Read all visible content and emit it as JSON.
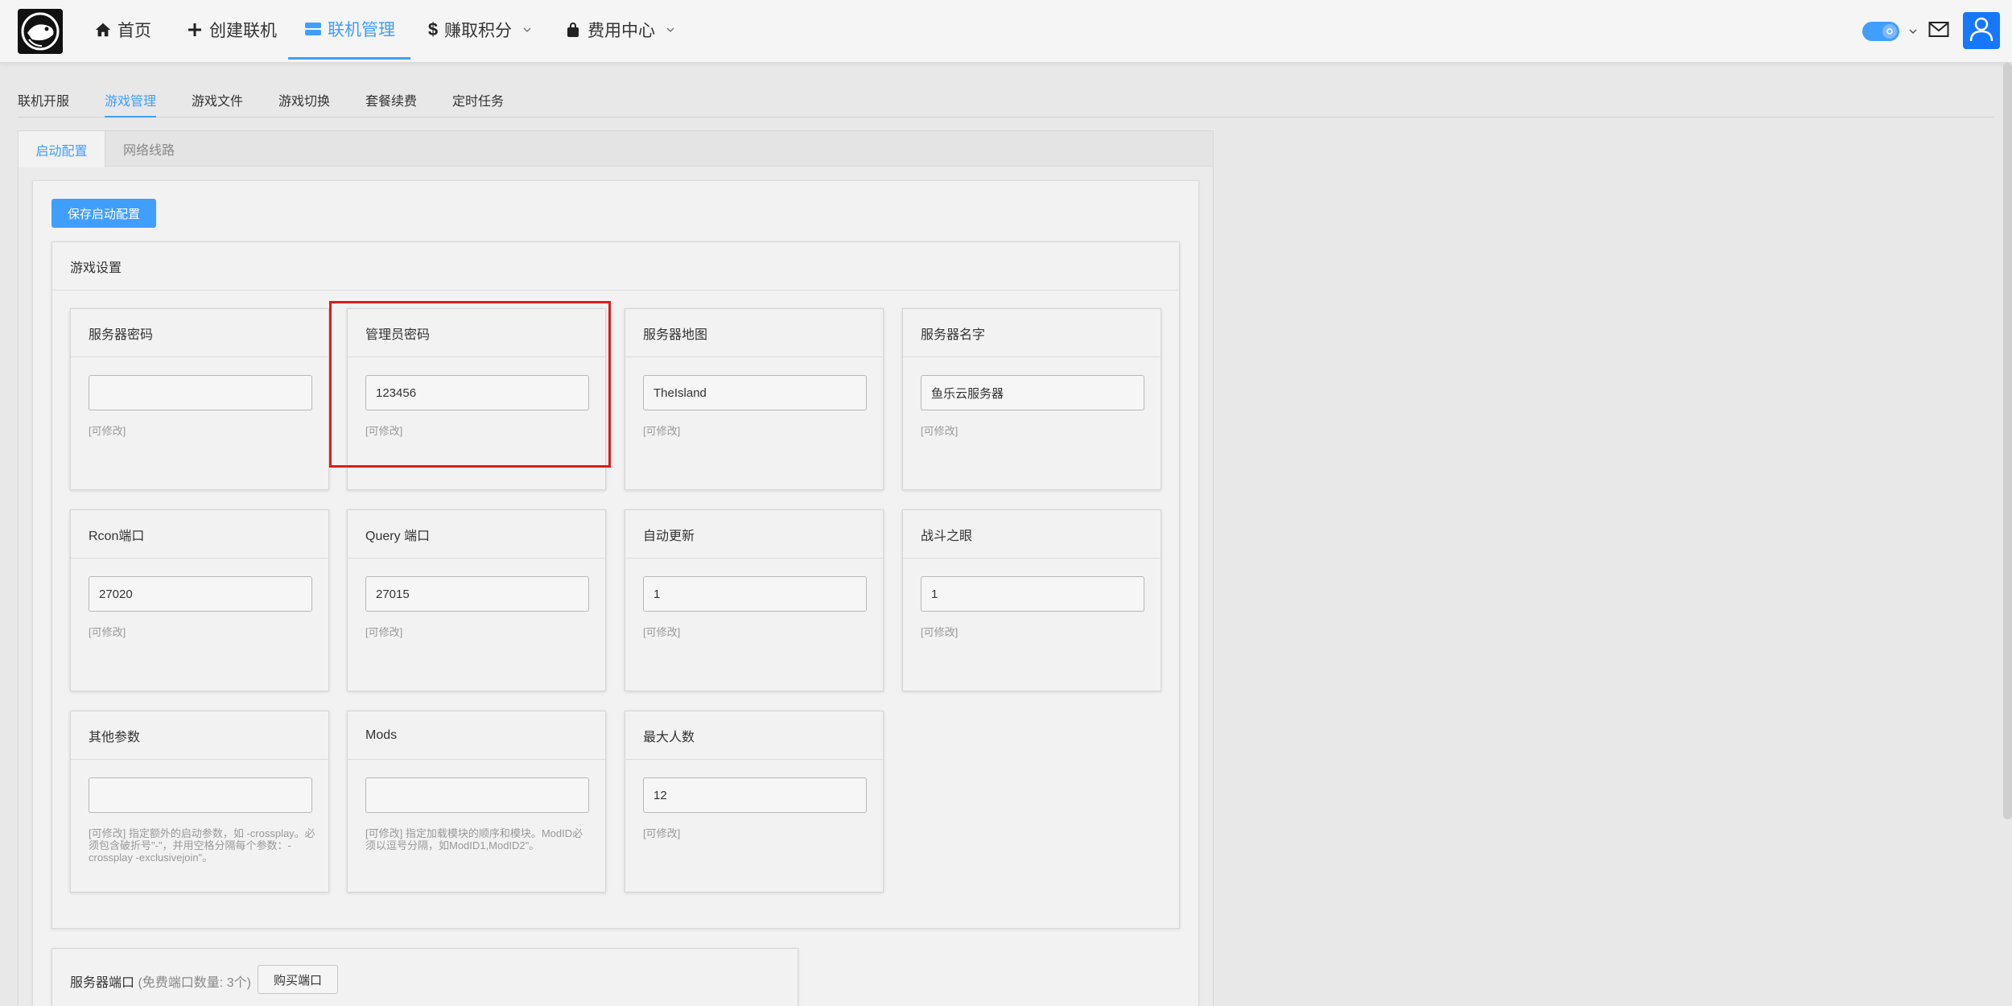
{
  "navbar": {
    "items": [
      {
        "label": "首页",
        "icon": "home-icon"
      },
      {
        "label": "创建联机",
        "icon": "plus-icon"
      },
      {
        "label": "联机管理",
        "icon": "server-icon",
        "active": true
      },
      {
        "label": "赚取积分",
        "icon": "dollar-icon",
        "dropdown": true
      },
      {
        "label": "费用中心",
        "icon": "bag-icon",
        "dropdown": true
      }
    ]
  },
  "subtabs": [
    {
      "label": "联机开服"
    },
    {
      "label": "游戏管理",
      "active": true
    },
    {
      "label": "游戏文件"
    },
    {
      "label": "游戏切换"
    },
    {
      "label": "套餐续费"
    },
    {
      "label": "定时任务"
    }
  ],
  "panel_tabs": [
    {
      "label": "启动配置",
      "active": true
    },
    {
      "label": "网络线路"
    }
  ],
  "save_button": "保存启动配置",
  "settings": {
    "title": "游戏设置",
    "fields": [
      {
        "label": "服务器密码",
        "value": "",
        "hint": "[可修改]"
      },
      {
        "label": "管理员密码",
        "value": "123456",
        "hint": "[可修改]"
      },
      {
        "label": "服务器地图",
        "value": "TheIsland",
        "hint": "[可修改]"
      },
      {
        "label": "服务器名字",
        "value": "鱼乐云服务器",
        "hint": "[可修改]"
      },
      {
        "label": "Rcon端口",
        "value": "27020",
        "hint": "[可修改]"
      },
      {
        "label": "Query 端口",
        "value": "27015",
        "hint": "[可修改]"
      },
      {
        "label": "自动更新",
        "value": "1",
        "hint": "[可修改]"
      },
      {
        "label": "战斗之眼",
        "value": "1",
        "hint": "[可修改]"
      },
      {
        "label": "其他参数",
        "value": "",
        "hint": "[可修改] 指定额外的启动参数，如 -crossplay。必须包含破折号\"-\"，并用空格分隔每个参数：-crossplay -exclusivejoin\"。"
      },
      {
        "label": "Mods",
        "value": "",
        "hint": "[可修改] 指定加载模块的顺序和模块。ModID必须以逗号分隔，如ModID1,ModID2\"。"
      },
      {
        "label": "最大人数",
        "value": "12",
        "hint": "[可修改]"
      }
    ]
  },
  "ports": {
    "title": "服务器端口",
    "note": "(免费端口数量: 3个)",
    "buy_button": "购买端口"
  },
  "colors": {
    "accent": "#409eff",
    "highlight": "#e01b1b"
  }
}
